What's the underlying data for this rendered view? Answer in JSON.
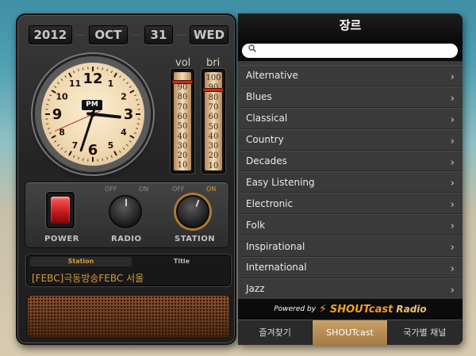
{
  "date": {
    "year": "2012",
    "month": "OCT",
    "day": "31",
    "weekday": "WED"
  },
  "clock": {
    "ampm": "PM",
    "numbers": [
      "12",
      "1",
      "2",
      "3",
      "4",
      "5",
      "6",
      "7",
      "8",
      "9",
      "10",
      "11"
    ],
    "hour": 3.2,
    "minute": 33,
    "second": 41
  },
  "meters": {
    "vol": {
      "label": "vol",
      "scale": [
        "90",
        "80",
        "70",
        "60",
        "50",
        "40",
        "30",
        "20",
        "10"
      ],
      "level": 100
    },
    "bri": {
      "label": "bri",
      "scale": [
        "100",
        "90",
        "80",
        "70",
        "60",
        "50",
        "40",
        "30",
        "20",
        "10"
      ],
      "level": 90
    }
  },
  "controls": {
    "power_label": "POWER",
    "radio": {
      "label": "RADIO",
      "off": "OFF",
      "on": "ON"
    },
    "station": {
      "label": "STATION",
      "off": "OFF",
      "on": "ON"
    }
  },
  "display": {
    "station_tab": "Station",
    "title_tab": "Title",
    "station_name": "[FEBC]극동방송FEBC 서울"
  },
  "panel": {
    "title": "장르",
    "search_placeholder": "",
    "genres": [
      "Alternative",
      "Blues",
      "Classical",
      "Country",
      "Decades",
      "Easy Listening",
      "Electronic",
      "Folk",
      "Inspirational",
      "International",
      "Jazz"
    ],
    "powered_by": "Powered by",
    "brand": "SHOUTcast",
    "brand_suffix": "Radio",
    "tabs": [
      "즐겨찾기",
      "SHOUTcast",
      "국가별 채널"
    ],
    "active_tab": 1
  },
  "colors": {
    "accent": "#d59a3a",
    "active_tab": "#b58a54",
    "panel_bg": "#3b3b3b"
  }
}
